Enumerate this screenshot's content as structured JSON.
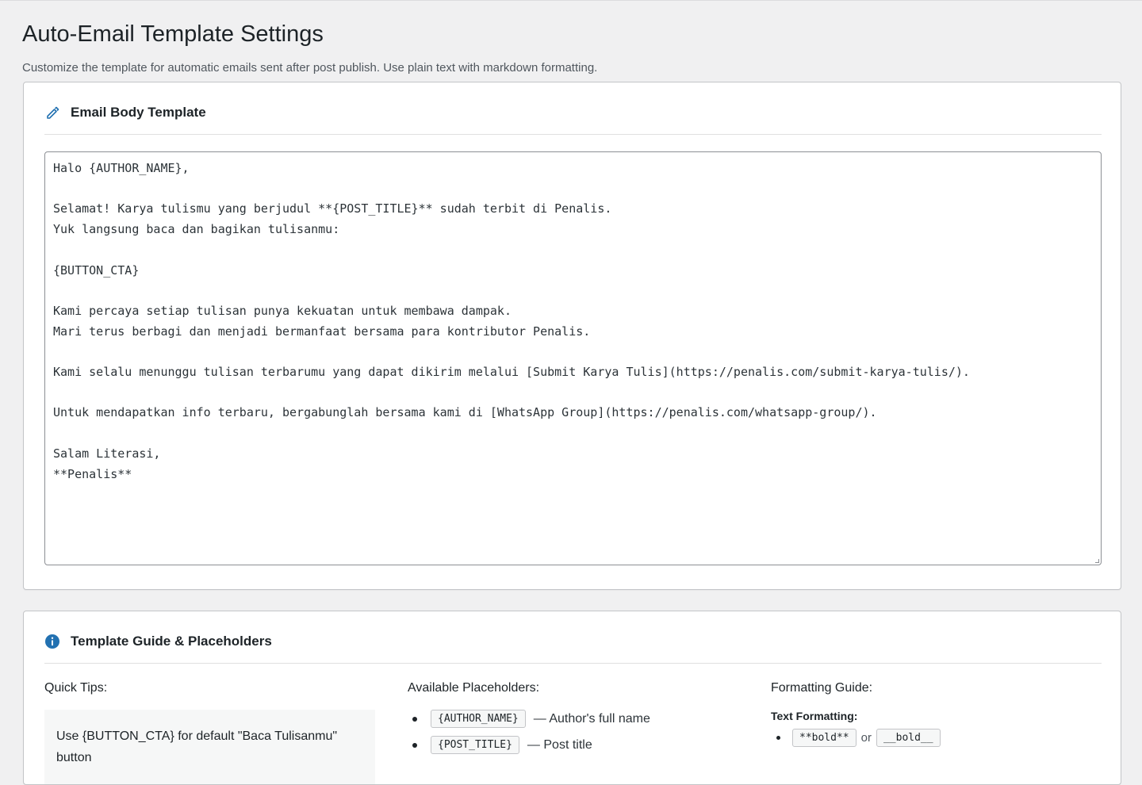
{
  "page": {
    "title": "Auto-Email Template Settings",
    "description": "Customize the template for automatic emails sent after post publish. Use plain text with markdown formatting."
  },
  "editor_card": {
    "title": "Email Body Template",
    "icon": "pencil-icon",
    "template_text": "Halo {AUTHOR_NAME},\n\nSelamat! Karya tulismu yang berjudul **{POST_TITLE}** sudah terbit di Penalis.\nYuk langsung baca dan bagikan tulisanmu:\n\n{BUTTON_CTA}\n\nKami percaya setiap tulisan punya kekuatan untuk membawa dampak.\nMari terus berbagi dan menjadi bermanfaat bersama para kontributor Penalis.\n\nKami selalu menunggu tulisan terbarumu yang dapat dikirim melalui [Submit Karya Tulis](https://penalis.com/submit-karya-tulis/).\n\nUntuk mendapatkan info terbaru, bergabunglah bersama kami di [WhatsApp Group](https://penalis.com/whatsapp-group/).\n\nSalam Literasi,\n**Penalis**"
  },
  "guide_card": {
    "title": "Template Guide & Placeholders",
    "icon": "info-icon",
    "quick_tips": {
      "heading": "Quick Tips:",
      "tip": "Use {BUTTON_CTA} for default \"Baca Tulisanmu\" button"
    },
    "placeholders": {
      "heading": "Available Placeholders:",
      "items": [
        {
          "code": "{AUTHOR_NAME}",
          "desc": "— Author's full name"
        },
        {
          "code": "{POST_TITLE}",
          "desc": "— Post title"
        }
      ]
    },
    "formatting": {
      "heading": "Formatting Guide:",
      "subheading": "Text Formatting:",
      "bold_a": "**bold**",
      "or_text": "or",
      "bold_b": "__bold__"
    }
  },
  "colors": {
    "accent": "#2271b1",
    "background": "#f0f0f1",
    "card_border": "#c3c4c7"
  }
}
